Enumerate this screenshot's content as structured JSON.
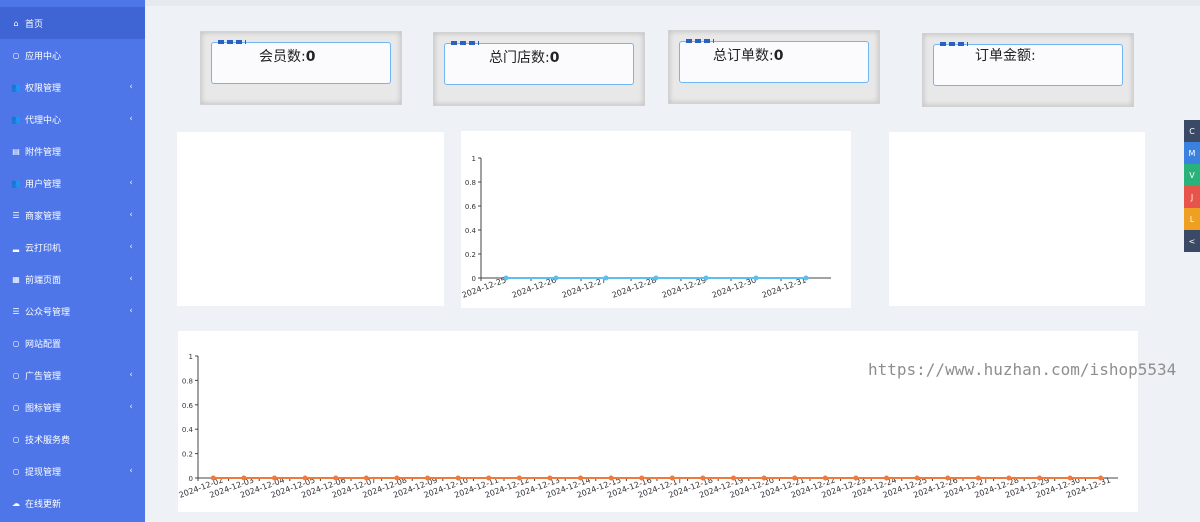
{
  "sidebar": {
    "items": [
      {
        "label": "首页",
        "icon": "home-icon",
        "glyph": "⌂",
        "chev": false
      },
      {
        "label": "应用中心",
        "icon": "circle-icon",
        "glyph": "○",
        "chev": false
      },
      {
        "label": "权限管理",
        "icon": "users-icon",
        "glyph": "👥",
        "chev": true
      },
      {
        "label": "代理中心",
        "icon": "users-icon",
        "glyph": "👥",
        "chev": true
      },
      {
        "label": "附件管理",
        "icon": "file-icon",
        "glyph": "▤",
        "chev": false
      },
      {
        "label": "用户管理",
        "icon": "users-icon",
        "glyph": "👥",
        "chev": true
      },
      {
        "label": "商家管理",
        "icon": "list-icon",
        "glyph": "☰",
        "chev": true
      },
      {
        "label": "云打印机",
        "icon": "bed-icon",
        "glyph": "▂",
        "chev": true
      },
      {
        "label": "前端页面",
        "icon": "grid-icon",
        "glyph": "▦",
        "chev": true
      },
      {
        "label": "公众号管理",
        "icon": "list-icon",
        "glyph": "☰",
        "chev": true
      },
      {
        "label": "网站配置",
        "icon": "circle-icon",
        "glyph": "○",
        "chev": false
      },
      {
        "label": "广告管理",
        "icon": "circle-icon",
        "glyph": "○",
        "chev": true
      },
      {
        "label": "图标管理",
        "icon": "circle-icon",
        "glyph": "○",
        "chev": true
      },
      {
        "label": "技术服务费",
        "icon": "circle-icon",
        "glyph": "○",
        "chev": false
      },
      {
        "label": "提现管理",
        "icon": "circle-icon",
        "glyph": "○",
        "chev": true
      },
      {
        "label": "在线更新",
        "icon": "cloud-upload-icon",
        "glyph": "☁",
        "chev": false
      }
    ],
    "chevron_glyph": "‹"
  },
  "stats": [
    {
      "label": "会员数:",
      "value": "0"
    },
    {
      "label": "总门店数:",
      "value": "0"
    },
    {
      "label": "总订单数:",
      "value": "0"
    },
    {
      "label": "订单金额:",
      "value": ""
    }
  ],
  "float_buttons": [
    {
      "label": "C",
      "color": "#3a4a66"
    },
    {
      "label": "M",
      "color": "#3b82e0"
    },
    {
      "label": "V",
      "color": "#2ab27b"
    },
    {
      "label": "J",
      "color": "#e8534b"
    },
    {
      "label": "L",
      "color": "#f0a020"
    },
    {
      "label": "<",
      "color": "#3a4a66"
    }
  ],
  "watermark": "https://www.huzhan.com/ishop5534",
  "chart_data": [
    {
      "type": "line",
      "categories": [
        "2024-12-25",
        "2024-12-26",
        "2024-12-27",
        "2024-12-28",
        "2024-12-29",
        "2024-12-30",
        "2024-12-31"
      ],
      "series": [
        {
          "values": [
            0,
            0,
            0,
            0,
            0,
            0,
            0
          ],
          "color": "#5bc0f0"
        }
      ],
      "yticks": [
        "0",
        "0.2",
        "0.4",
        "0.6",
        "0.8",
        "1"
      ],
      "ylim": [
        0,
        1
      ]
    },
    {
      "type": "line",
      "categories": [
        "2024-12-02",
        "2024-12-03",
        "2024-12-04",
        "2024-12-05",
        "2024-12-06",
        "2024-12-07",
        "2024-12-08",
        "2024-12-09",
        "2024-12-10",
        "2024-12-11",
        "2024-12-12",
        "2024-12-13",
        "2024-12-14",
        "2024-12-15",
        "2024-12-16",
        "2024-12-17",
        "2024-12-18",
        "2024-12-19",
        "2024-12-20",
        "2024-12-21",
        "2024-12-22",
        "2024-12-23",
        "2024-12-24",
        "2024-12-25",
        "2024-12-26",
        "2024-12-27",
        "2024-12-28",
        "2024-12-29",
        "2024-12-30",
        "2024-12-31"
      ],
      "series": [
        {
          "values": [
            0,
            0,
            0,
            0,
            0,
            0,
            0,
            0,
            0,
            0,
            0,
            0,
            0,
            0,
            0,
            0,
            0,
            0,
            0,
            0,
            0,
            0,
            0,
            0,
            0,
            0,
            0,
            0,
            0,
            0
          ],
          "color": "#f07a3c"
        }
      ],
      "yticks": [
        "0",
        "0.2",
        "0.4",
        "0.6",
        "0.8",
        "1"
      ],
      "ylim": [
        0,
        1
      ]
    }
  ]
}
